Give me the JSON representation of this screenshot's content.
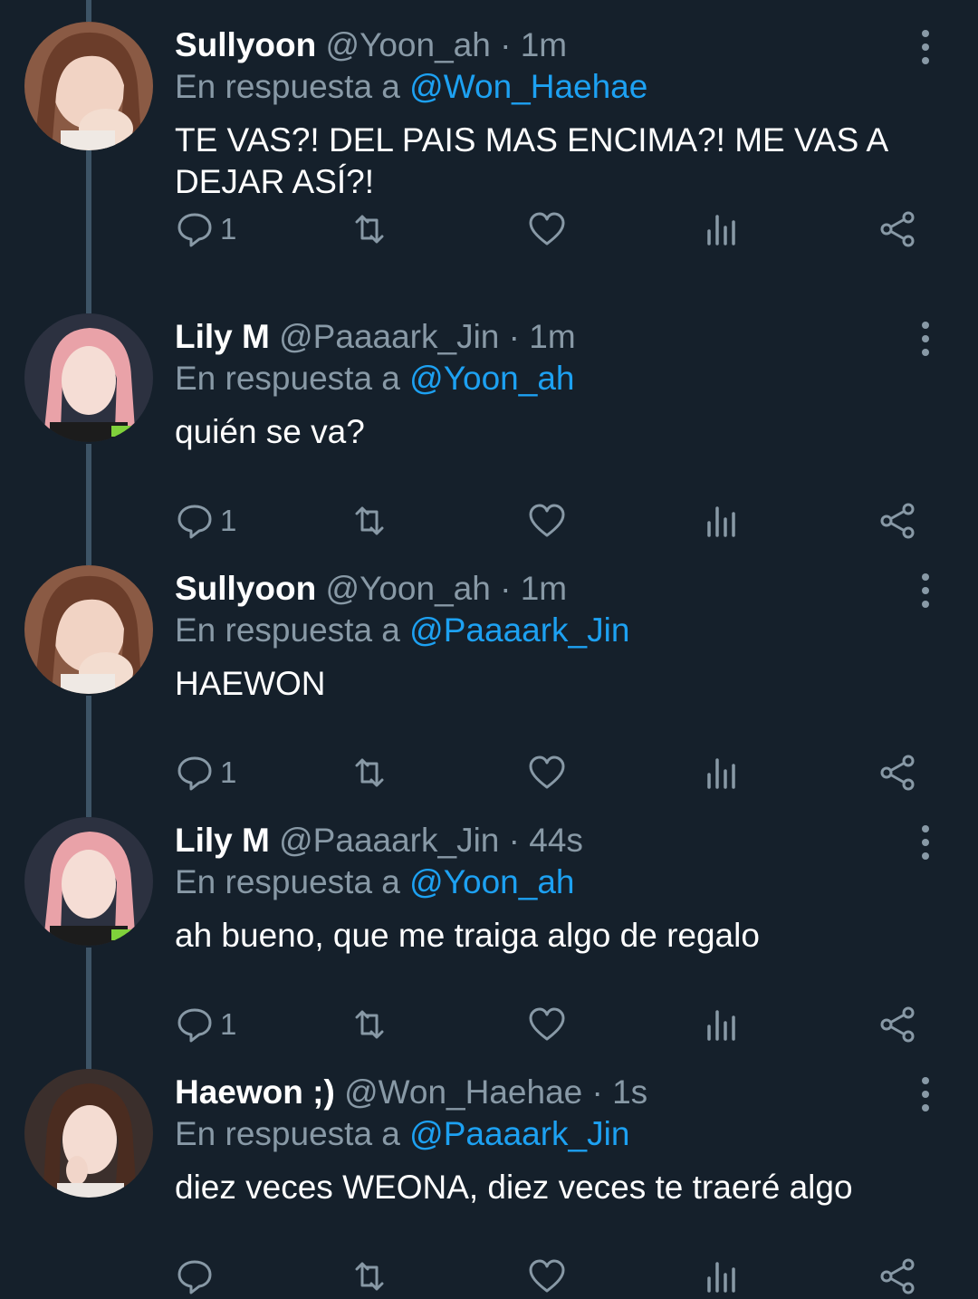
{
  "reply_prefix": "En respuesta a",
  "colors": {
    "background": "#15202b",
    "muted": "#8899a6",
    "link": "#1da1f2",
    "thread": "#3d5466"
  },
  "tweets": [
    {
      "name": "Sullyoon",
      "handle": "@Yoon_ah",
      "sep": "·",
      "time": "1m",
      "reply_to": "@Won_Haehae",
      "text": "TE VAS?! DEL PAIS MAS ENCIMA?! ME VAS A DEJAR ASÍ?!",
      "replies": "1"
    },
    {
      "name": "Lily M",
      "handle": "@Paaaark_Jin",
      "sep": "·",
      "time": "1m",
      "reply_to": "@Yoon_ah",
      "text": "quién se va?",
      "replies": "1"
    },
    {
      "name": "Sullyoon",
      "handle": "@Yoon_ah",
      "sep": "·",
      "time": "1m",
      "reply_to": "@Paaaark_Jin",
      "text": "HAEWON",
      "replies": "1"
    },
    {
      "name": "Lily M",
      "handle": "@Paaaark_Jin",
      "sep": "·",
      "time": "44s",
      "reply_to": "@Yoon_ah",
      "text": "ah bueno, que me traiga algo de regalo",
      "replies": "1"
    },
    {
      "name": "Haewon ;)",
      "handle": "@Won_Haehae",
      "sep": "·",
      "time": "1s",
      "reply_to": "@Paaaark_Jin",
      "text": "diez veces WEONA, diez veces te traeré algo",
      "replies": ""
    }
  ],
  "icons": [
    "reply-icon",
    "retweet-icon",
    "like-icon",
    "analytics-icon",
    "share-icon",
    "more-options-icon"
  ]
}
